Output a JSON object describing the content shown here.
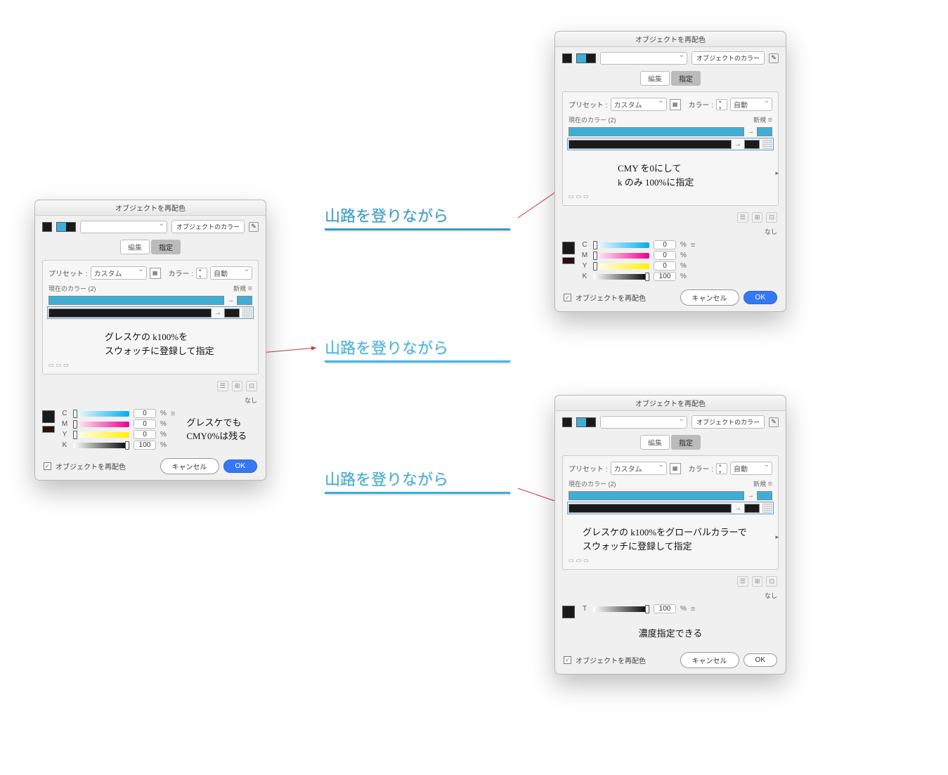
{
  "shared": {
    "dialog_title": "オブジェクトを再配色",
    "obj_color_btn": "オブジェクトのカラー",
    "tabs": {
      "edit": "編集",
      "assign": "指定"
    },
    "preset_label": "プリセット :",
    "preset_value": "カスタム",
    "color_label": "カラー :",
    "color_value": "自動",
    "current_colors_label": "現在のカラー (2)",
    "new_label": "新規",
    "recolor_checkbox": "オブジェクトを再配色",
    "cancel": "キャンセル",
    "ok": "OK",
    "none_label": "なし",
    "percent": "%"
  },
  "dialog_left": {
    "note1": "グレスケの k100%を\nスウォッチに登録して指定",
    "note2": "グレスケでも\nCMY0%は残る",
    "cmyk": {
      "C": 0,
      "M": 0,
      "Y": 0,
      "K": 100
    }
  },
  "dialog_top_right": {
    "note": "CMY を0にして\nk のみ 100%に指定",
    "cmyk": {
      "C": 0,
      "M": 0,
      "Y": 0,
      "K": 100
    }
  },
  "dialog_bottom_right": {
    "note1": "グレスケの k100%をグローバルカラーで\nスウォッチに登録して指定",
    "note2": "濃度指定できる",
    "T": {
      "label": "T",
      "value": 100
    }
  },
  "samples": {
    "text": "山路を登りながら"
  }
}
